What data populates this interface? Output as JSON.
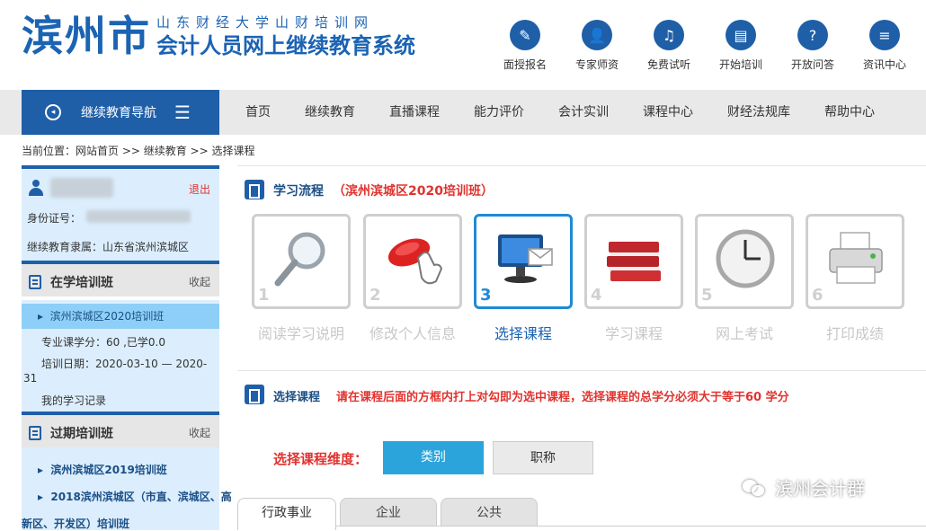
{
  "header": {
    "logo_big": "滨州市",
    "logo_sub1": "山东财经大学山财培训网",
    "logo_sub2": "会计人员网上继续教育系统",
    "quick_links": [
      {
        "label": "面授报名",
        "icon": "pen-icon"
      },
      {
        "label": "专家师资",
        "icon": "expert-icon"
      },
      {
        "label": "免费试听",
        "icon": "headphones-icon"
      },
      {
        "label": "开始培训",
        "icon": "book-icon"
      },
      {
        "label": "开放问答",
        "icon": "question-icon"
      },
      {
        "label": "资讯中心",
        "icon": "document-icon"
      }
    ]
  },
  "nav": {
    "side_title": "继续教育导航",
    "items": [
      "首页",
      "继续教育",
      "直播课程",
      "能力评价",
      "会计实训",
      "课程中心",
      "财经法规库",
      "帮助中心"
    ]
  },
  "breadcrumb": "当前位置：网站首页 >> 继续教育 >> 选择课程",
  "user": {
    "logout": "退出",
    "id_label": "身份证号：",
    "org_label": "继续教育隶属：山东省滨州滨城区"
  },
  "current": {
    "title": "在学培训班",
    "collapse": "收起",
    "class_name": "滨州滨城区2020培训班",
    "credits": "专业课学分：60 ,已学0.0",
    "dates_line1": "培训日期：2020-03-10 — 2020-12-",
    "dates_line2": "31",
    "records": "我的学习记录"
  },
  "expired": {
    "title": "过期培训班",
    "collapse": "收起",
    "class1": "滨州滨城区2019培训班",
    "class2_line1": "2018滨州滨城区（市直、滨城区、高",
    "class2_line2": "新区、开发区）培训班"
  },
  "flow": {
    "title": "学习流程",
    "class_name": "（滨州滨城区2020培训班）",
    "steps": [
      {
        "num": "1",
        "label": "阅读学习说明"
      },
      {
        "num": "2",
        "label": "修改个人信息"
      },
      {
        "num": "3",
        "label": "选择课程"
      },
      {
        "num": "4",
        "label": "学习课程"
      },
      {
        "num": "5",
        "label": "网上考试"
      },
      {
        "num": "6",
        "label": "打印成绩"
      }
    ],
    "active_step": 3
  },
  "select": {
    "title": "选择课程",
    "instruction": "请在课程后面的方框内打上对勾即为选中课程，选择课程的总学分必须大于等于60 学分",
    "dimension_label": "选择课程维度：",
    "dimension_options": [
      "类别",
      "职称"
    ],
    "active_dimension": "类别",
    "tabs": [
      "行政事业",
      "企业",
      "公共"
    ],
    "active_tab": "行政事业"
  },
  "watermark": "滨州会计群",
  "colors": {
    "brand_blue": "#1f5fa8",
    "accent_red": "#e0332e",
    "active_light_blue": "#8ecff7",
    "button_blue": "#2ba4dc"
  }
}
